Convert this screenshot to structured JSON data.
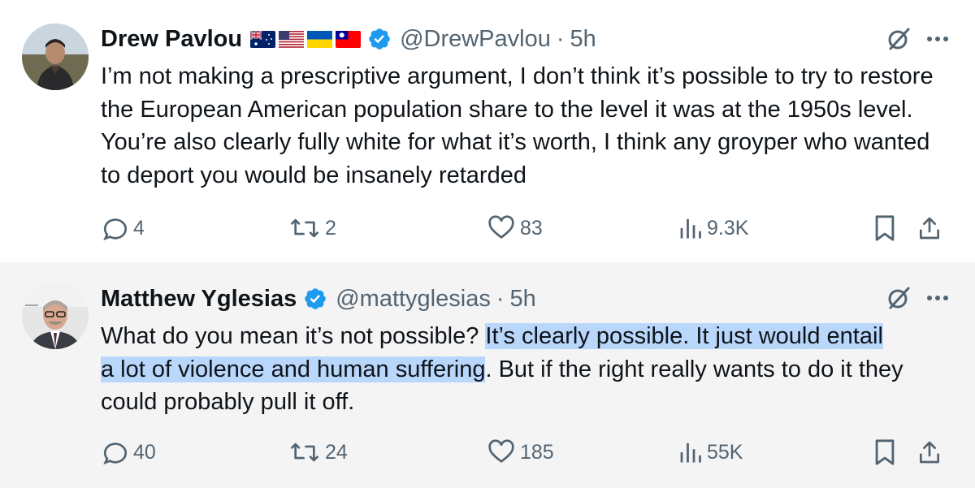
{
  "tweets": [
    {
      "author_name": "Drew Pavlou",
      "flags": [
        "australia-flag",
        "usa-flag",
        "ukraine-flag",
        "taiwan-flag"
      ],
      "handle": "@DrewPavlou",
      "separator": "·",
      "time": "5h",
      "text": "I’m not making a prescriptive argument, I don’t think it’s possible to try to restore the European American population share to the level it was at the 1950s level. You’re also clearly fully white for what it’s worth, I think any groyper who wanted to deport you would be insanely retarded",
      "replies": "4",
      "reposts": "2",
      "likes": "83",
      "views": "9.3K"
    },
    {
      "author_name": "Matthew Yglesias",
      "handle": "@mattyglesias",
      "separator": "·",
      "time": "5h",
      "text_before": "What do you mean it’s not possible? ",
      "text_highlighted_line1": "It’s clearly possible. It just would entail",
      "text_highlighted_line2": "a lot of violence and human suffering",
      "text_after": ". But if the right really wants to do it they could probably pull it off.",
      "replies": "40",
      "reposts": "24",
      "likes": "185",
      "views": "55K"
    }
  ],
  "colors": {
    "text": "#0f1419",
    "secondary": "#536471",
    "verified": "#1d9bf0",
    "highlight": "#b9d6fb",
    "second_tweet_bg": "#f4f4f5"
  }
}
